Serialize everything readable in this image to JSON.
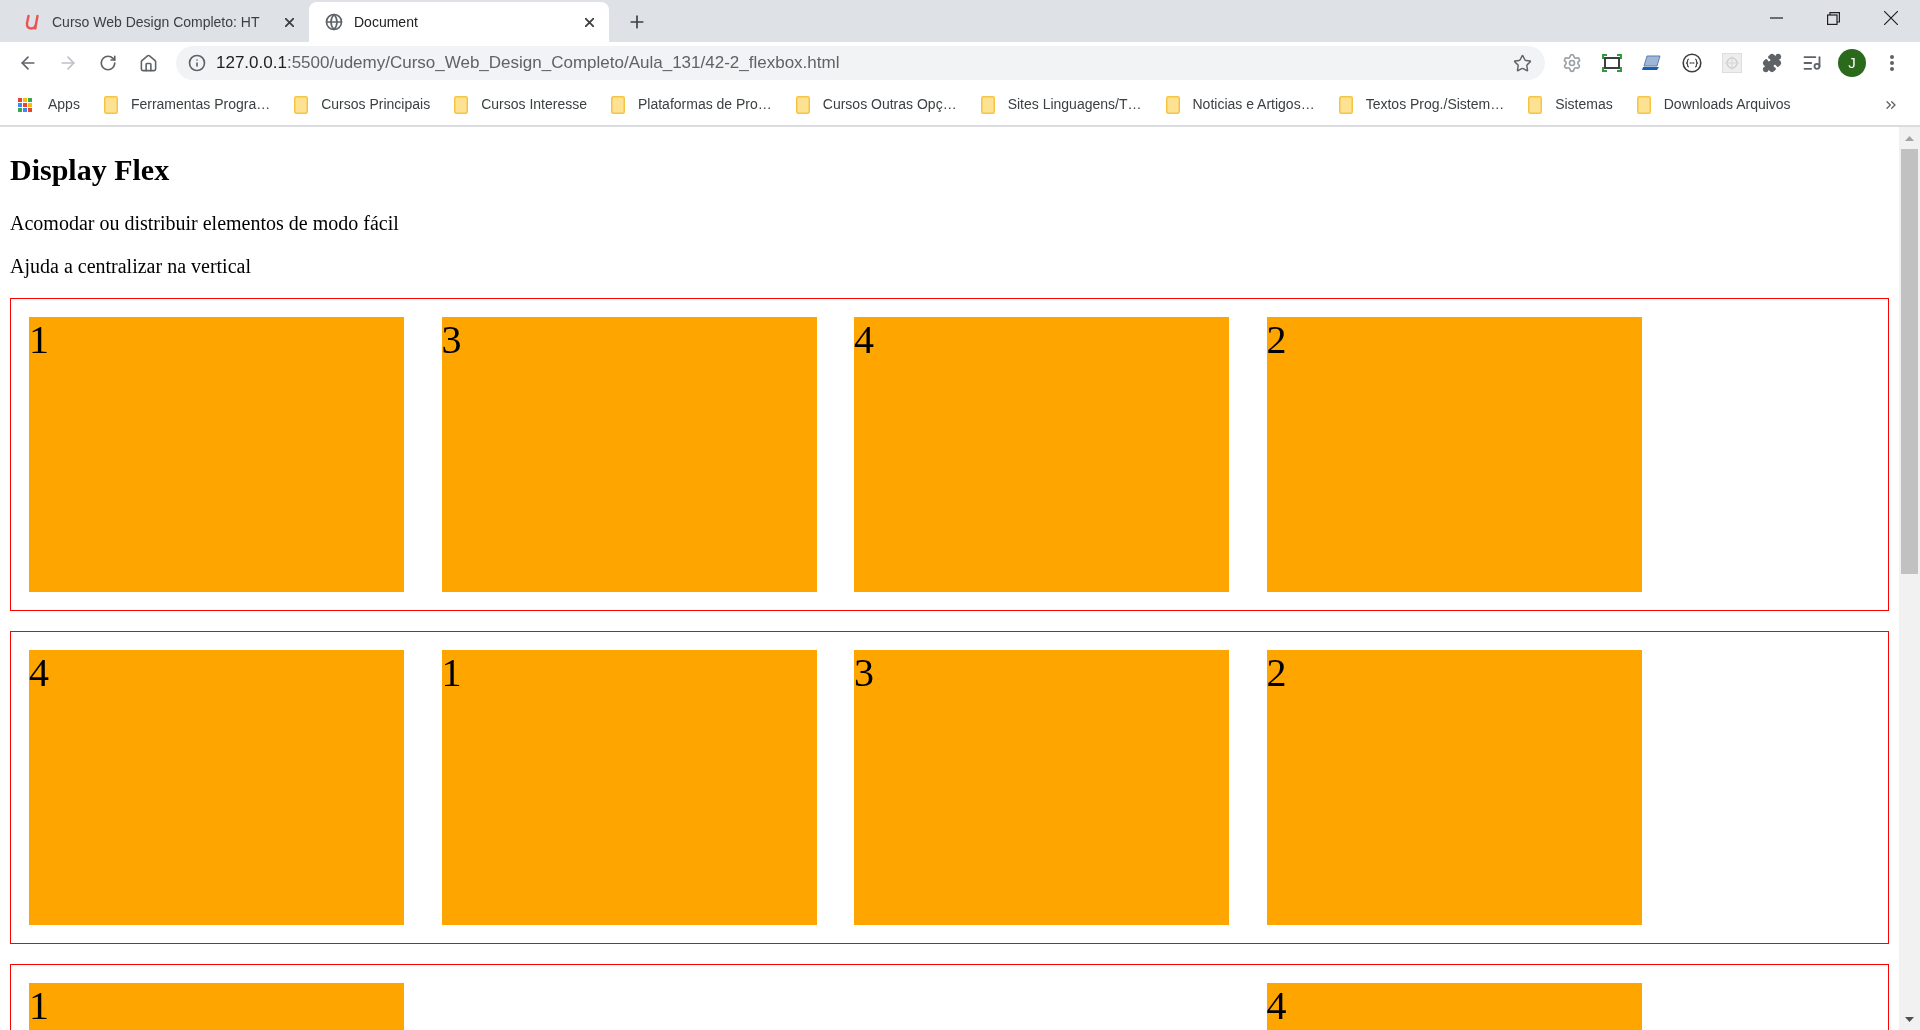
{
  "tabs": [
    {
      "title": "Curso Web Design Completo: HT",
      "kind": "udemy",
      "selected": false
    },
    {
      "title": "Document",
      "kind": "globe",
      "selected": true
    }
  ],
  "toolbar": {
    "back": {
      "disabled": false
    },
    "forward": {
      "disabled": true
    },
    "address": {
      "host": "127.0.0.1",
      "path": ":5500/udemy/Curso_Web_Design_Completo/Aula_131/42-2_flexbox.html"
    },
    "profile": {
      "initial": "J"
    }
  },
  "bookmarks": [
    {
      "kind": "apps",
      "label": "Apps"
    },
    {
      "kind": "folder",
      "label": "Ferramentas Progra…"
    },
    {
      "kind": "folder",
      "label": "Cursos Principais"
    },
    {
      "kind": "folder",
      "label": "Cursos Interesse"
    },
    {
      "kind": "folder",
      "label": "Plataformas de Pro…"
    },
    {
      "kind": "folder",
      "label": "Cursos Outras Opç…"
    },
    {
      "kind": "folder",
      "label": "Sites Linguagens/T…"
    },
    {
      "kind": "folder",
      "label": "Noticias e Artigos…"
    },
    {
      "kind": "folder",
      "label": "Textos Prog./Sistem…"
    },
    {
      "kind": "folder",
      "label": "Sistemas"
    },
    {
      "kind": "folder",
      "label": "Downloads Arquivos"
    }
  ],
  "page": {
    "heading": "Display Flex",
    "paragraphs": [
      "Acomodar ou distribuir elementos de modo fácil",
      "Ajuda a centralizar na vertical"
    ],
    "containers": [
      {
        "items": [
          {
            "kind": "box",
            "label": "1"
          },
          {
            "kind": "box",
            "label": "3"
          },
          {
            "kind": "box",
            "label": "4"
          },
          {
            "kind": "box",
            "label": "2"
          }
        ]
      },
      {
        "items": [
          {
            "kind": "box",
            "label": "4"
          },
          {
            "kind": "box",
            "label": "1"
          },
          {
            "kind": "box",
            "label": "3"
          },
          {
            "kind": "box",
            "label": "2"
          }
        ]
      },
      {
        "items": [
          {
            "kind": "box",
            "label": "1"
          },
          {
            "kind": "empty"
          },
          {
            "kind": "empty"
          },
          {
            "kind": "box",
            "label": "4"
          }
        ]
      }
    ]
  }
}
